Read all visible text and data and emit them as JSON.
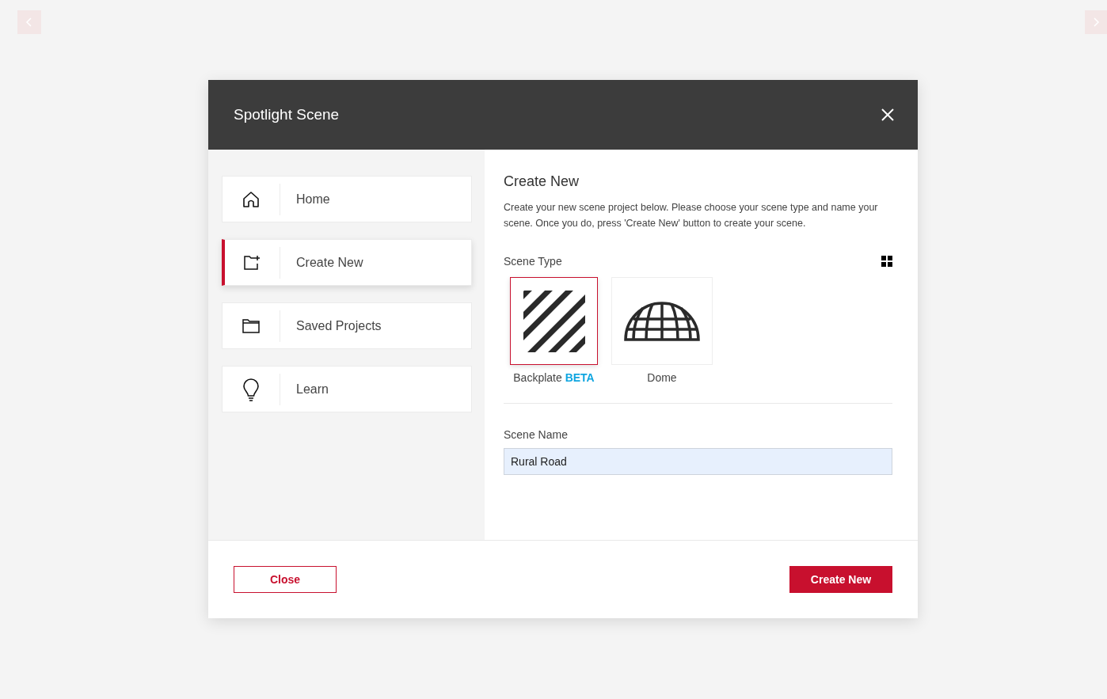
{
  "dialog": {
    "title": "Spotlight Scene"
  },
  "nav": [
    {
      "label": "Home",
      "kind": "home",
      "selected": false
    },
    {
      "label": "Create New",
      "kind": "create",
      "selected": true
    },
    {
      "label": "Saved Projects",
      "kind": "folder",
      "selected": false
    },
    {
      "label": "Learn",
      "kind": "learn",
      "selected": false
    }
  ],
  "panel": {
    "heading": "Create New",
    "description": "Create your new scene project below. Please choose your scene type and name your scene. Once you do, press 'Create New' button to create your scene.",
    "scene_type_label": "Scene Type",
    "scene_types": [
      {
        "label": "Backplate **BETA**",
        "kind": "backplate",
        "selected": true
      },
      {
        "label": "Dome",
        "kind": "dome",
        "selected": false
      }
    ],
    "scene_name_label": "Scene Name",
    "scene_name": {
      "value": "Rural Road"
    }
  },
  "footer": {
    "close": "Close",
    "create": "Create New"
  }
}
